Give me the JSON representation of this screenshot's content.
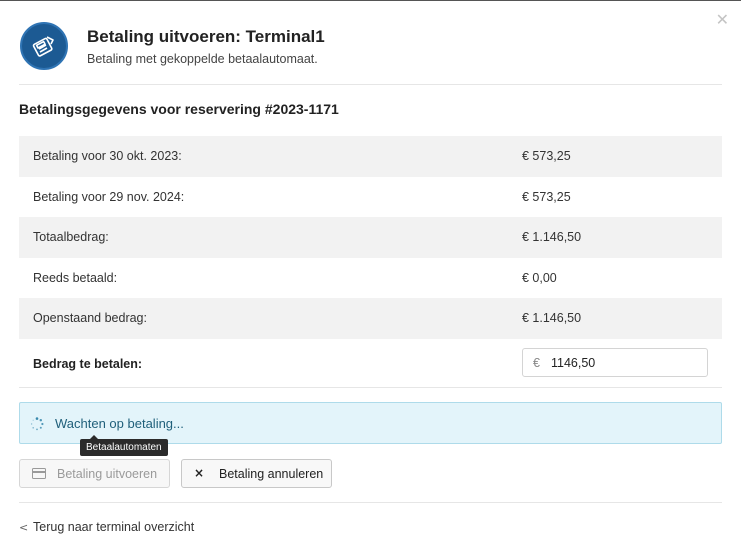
{
  "dialog": {
    "title": "Betaling uitvoeren: Terminal1",
    "subtitle": "Betaling met gekoppelde betaalautomaat.",
    "close_icon": "close-icon",
    "logo_icon": "payment-terminal-icon"
  },
  "section": {
    "title": "Betalingsgegevens voor reservering #2023-1171"
  },
  "rows": [
    {
      "label": "Betaling voor 30 okt. 2023:",
      "value": "€ 573,25"
    },
    {
      "label": "Betaling voor 29 nov. 2024:",
      "value": "€ 573,25"
    },
    {
      "label": "Totaalbedrag:",
      "value": "€ 1.146,50"
    },
    {
      "label": "Reeds betaald:",
      "value": "€ 0,00"
    },
    {
      "label": "Openstaand bedrag:",
      "value": "€ 1.146,50"
    }
  ],
  "payment": {
    "label": "Bedrag te betalen:",
    "currency": "€",
    "amount": "1146,50"
  },
  "status": {
    "message": "Wachten op betaling..."
  },
  "tooltip": {
    "text": "Betaalautomaten"
  },
  "buttons": {
    "execute_label": "Betaling uitvoeren",
    "cancel_label": "Betaling annuleren",
    "cancel_icon": "×"
  },
  "footer": {
    "back_chevron": "<",
    "back_label": "Terug naar terminal overzicht"
  },
  "colors": {
    "logo_bg": "#1c5a93",
    "alert_bg": "#e3f4fa",
    "alert_text": "#1f5f7a",
    "row_stripe": "#f2f2f2"
  }
}
